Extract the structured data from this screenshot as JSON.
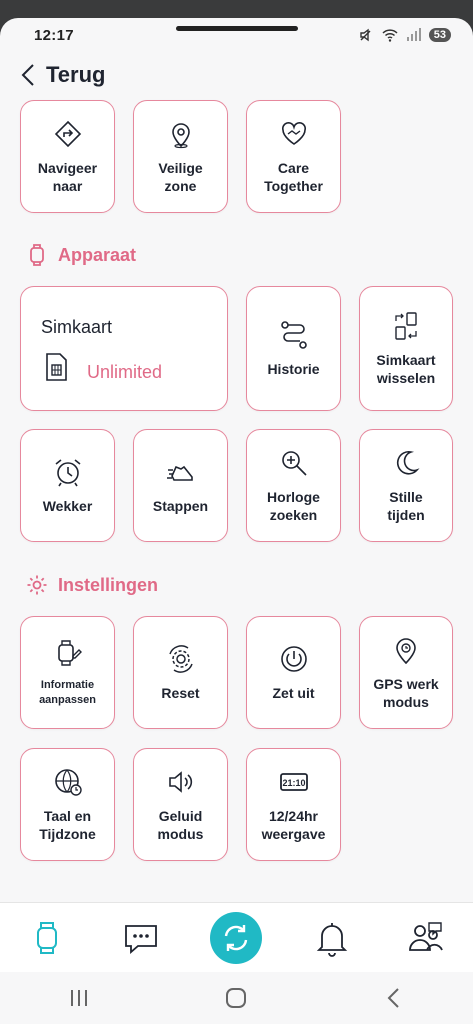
{
  "status_bar": {
    "time": "12:17",
    "battery": "53"
  },
  "header": {
    "back_label": "Terug"
  },
  "top_tiles": [
    {
      "label": "Navigeer\nnaar",
      "icon": "navigate-icon"
    },
    {
      "label": "Veilige\nzone",
      "icon": "location-pin-icon"
    },
    {
      "label": "Care\nTogether",
      "icon": "handshake-heart-icon"
    }
  ],
  "sections": {
    "device": "Apparaat",
    "settings": "Instellingen"
  },
  "sim": {
    "title": "Simkaart",
    "plan": "Unlimited"
  },
  "device_tiles": [
    {
      "label": "Historie",
      "icon": "route-history-icon"
    },
    {
      "label": "Simkaart\nwisselen",
      "icon": "sim-swap-icon"
    },
    {
      "label": "Wekker",
      "icon": "alarm-clock-icon"
    },
    {
      "label": "Stappen",
      "icon": "shoe-steps-icon"
    },
    {
      "label": "Horloge\nzoeken",
      "icon": "magnifier-icon"
    },
    {
      "label": "Stille\ntijden",
      "icon": "moon-icon"
    }
  ],
  "settings_tiles": [
    {
      "label": "Informatie\naanpassen",
      "icon": "watch-edit-icon"
    },
    {
      "label": "Reset",
      "icon": "reset-gear-icon"
    },
    {
      "label": "Zet uit",
      "icon": "power-icon"
    },
    {
      "label": "GPS werk\nmodus",
      "icon": "gps-pin-icon"
    },
    {
      "label": "Taal en\nTijdzone",
      "icon": "globe-clock-icon"
    },
    {
      "label": "Geluid\nmodus",
      "icon": "speaker-icon"
    },
    {
      "label": "12/24hr\nweergave",
      "icon": "clock-format-icon"
    }
  ],
  "clock_badge": "21:10",
  "colors": {
    "accent": "#e06a87",
    "tile_border": "#e6889d",
    "nav_active": "#20b9c5"
  }
}
